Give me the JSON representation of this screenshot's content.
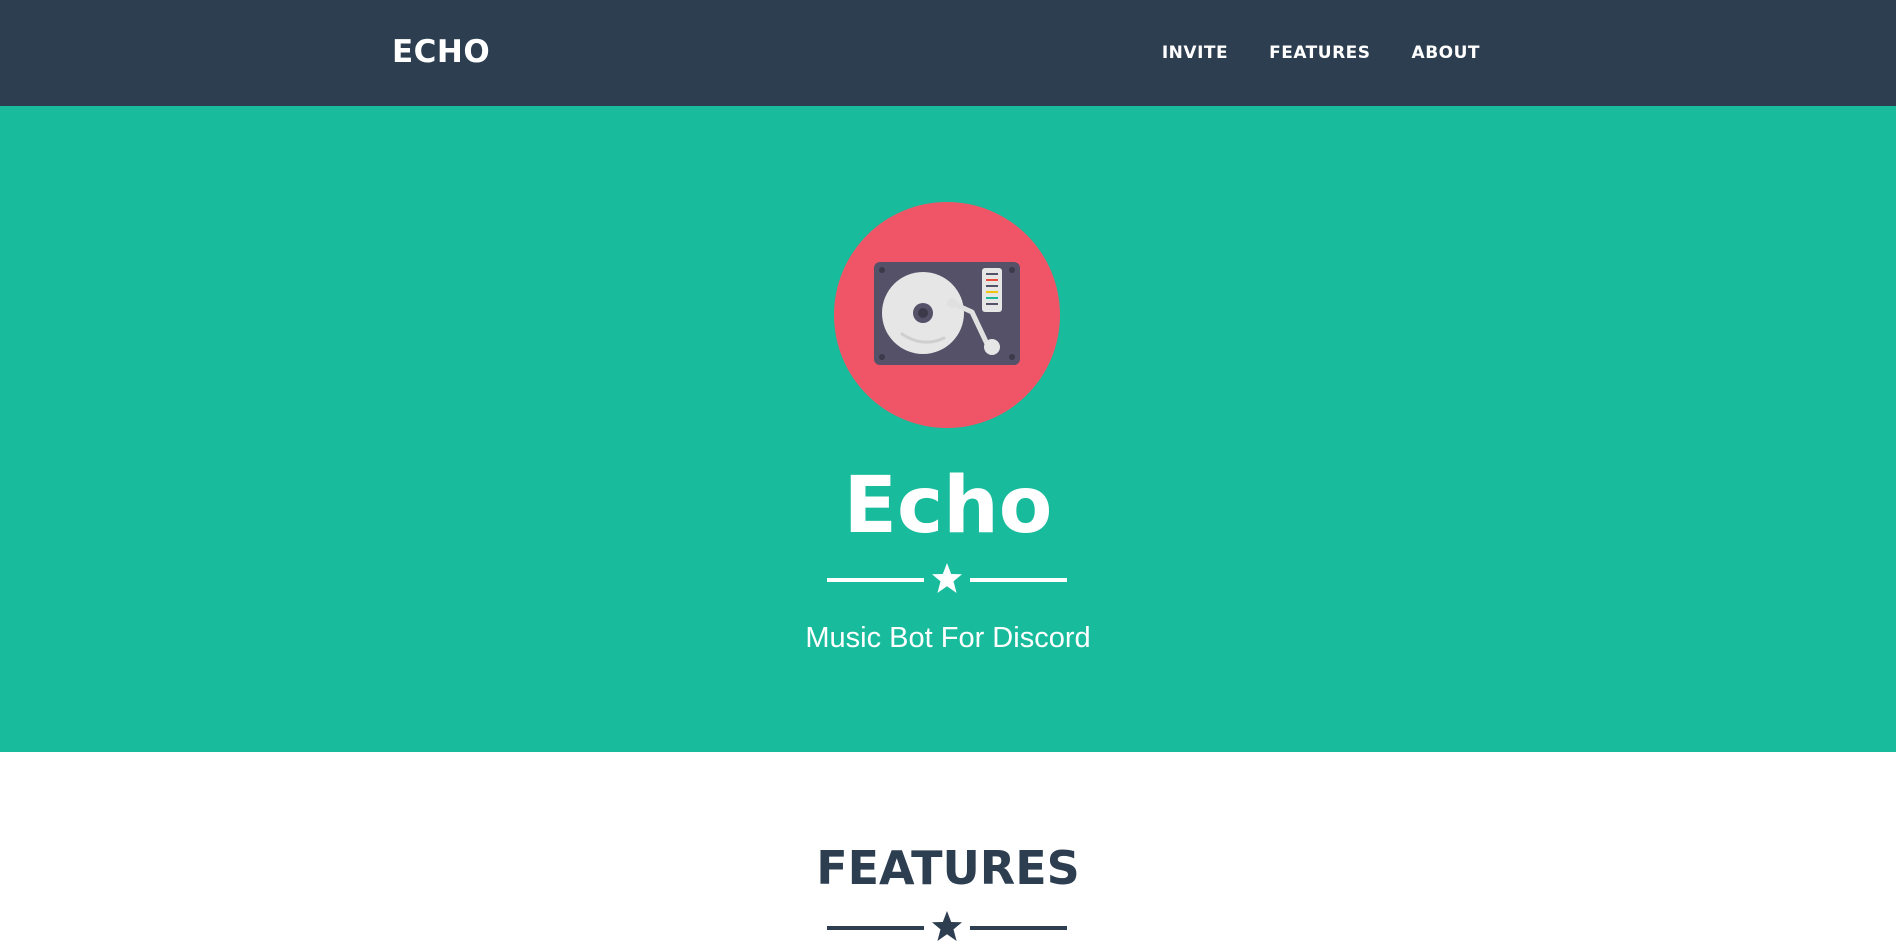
{
  "navbar": {
    "brand": "ECHO",
    "links": [
      "INVITE",
      "FEATURES",
      "ABOUT"
    ]
  },
  "hero": {
    "logo_icon": "turntable-icon",
    "title": "Echo",
    "divider_icon": "star-icon",
    "subtitle": "Music Bot For Discord"
  },
  "features": {
    "title": "FEATURES",
    "divider_icon": "star-icon"
  },
  "colors": {
    "navbar": "#2c3e50",
    "hero": "#18bc9c",
    "logo_circle": "#ef5566",
    "text_light": "#ffffff",
    "text_dark": "#2c3e50"
  }
}
